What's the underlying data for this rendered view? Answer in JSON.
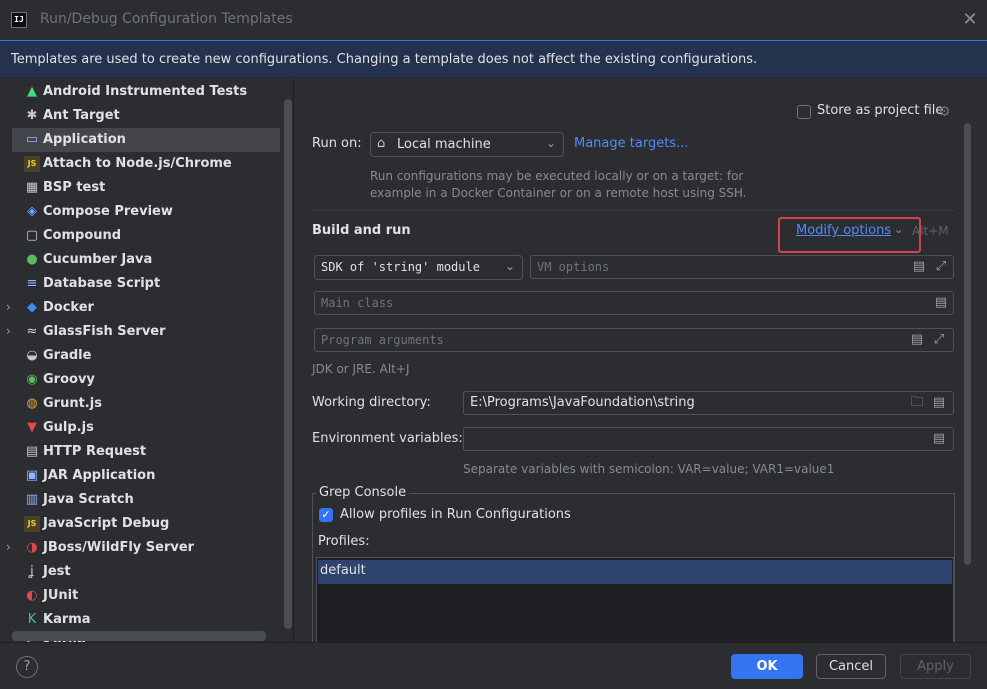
{
  "window": {
    "title": "Run/Debug Configuration Templates",
    "logo_text": "IJ",
    "close_glyph": "✕"
  },
  "banner": {
    "text": "Templates are used to create new configurations. Changing a template does not affect the existing configurations."
  },
  "sidebar": {
    "items": [
      {
        "label": "Android Instrumented Tests",
        "icon": "android-icon",
        "glyph": "▲",
        "color": "#3ddc84",
        "expandable": false,
        "selected": false
      },
      {
        "label": "Ant Target",
        "icon": "ant-icon",
        "glyph": "✱",
        "color": "#c7c7c7",
        "expandable": false,
        "selected": false
      },
      {
        "label": "Application",
        "icon": "application-icon",
        "glyph": "▭",
        "color": "#8fb3ff",
        "expandable": false,
        "selected": true
      },
      {
        "label": "Attach to Node.js/Chrome",
        "icon": "js-icon",
        "glyph": "JS",
        "color": "#f0c93c",
        "expandable": false,
        "selected": false
      },
      {
        "label": "BSP test",
        "icon": "bsp-icon",
        "glyph": "▦",
        "color": "#c7c7c7",
        "expandable": false,
        "selected": false
      },
      {
        "label": "Compose Preview",
        "icon": "compose-icon",
        "glyph": "◈",
        "color": "#6aa1ff",
        "expandable": false,
        "selected": false
      },
      {
        "label": "Compound",
        "icon": "compound-icon",
        "glyph": "▢",
        "color": "#c7c7c7",
        "expandable": false,
        "selected": false
      },
      {
        "label": "Cucumber Java",
        "icon": "cucumber-icon",
        "glyph": "●",
        "color": "#5fb85f",
        "expandable": false,
        "selected": false
      },
      {
        "label": "Database Script",
        "icon": "database-icon",
        "glyph": "≡",
        "color": "#8fb3ff",
        "expandable": false,
        "selected": false
      },
      {
        "label": "Docker",
        "icon": "docker-icon",
        "glyph": "◆",
        "color": "#3e8ef7",
        "expandable": true,
        "selected": false
      },
      {
        "label": "GlassFish Server",
        "icon": "glassfish-icon",
        "glyph": "≈",
        "color": "#d8d8d8",
        "expandable": true,
        "selected": false
      },
      {
        "label": "Gradle",
        "icon": "gradle-icon",
        "glyph": "◒",
        "color": "#c7c7c7",
        "expandable": false,
        "selected": false
      },
      {
        "label": "Groovy",
        "icon": "groovy-icon",
        "glyph": "◉",
        "color": "#5fb85f",
        "expandable": false,
        "selected": false
      },
      {
        "label": "Grunt.js",
        "icon": "grunt-icon",
        "glyph": "◍",
        "color": "#e3a33c",
        "expandable": false,
        "selected": false
      },
      {
        "label": "Gulp.js",
        "icon": "gulp-icon",
        "glyph": "▼",
        "color": "#e0484a",
        "expandable": false,
        "selected": false
      },
      {
        "label": "HTTP Request",
        "icon": "http-icon",
        "glyph": "▤",
        "color": "#c7c7c7",
        "expandable": false,
        "selected": false
      },
      {
        "label": "JAR Application",
        "icon": "jar-icon",
        "glyph": "▣",
        "color": "#8fb3ff",
        "expandable": false,
        "selected": false
      },
      {
        "label": "Java Scratch",
        "icon": "java-scratch-icon",
        "glyph": "▥",
        "color": "#8fb3ff",
        "expandable": false,
        "selected": false
      },
      {
        "label": "JavaScript Debug",
        "icon": "js-debug-icon",
        "glyph": "JS",
        "color": "#f0c93c",
        "expandable": false,
        "selected": false
      },
      {
        "label": "JBoss/WildFly Server",
        "icon": "jboss-icon",
        "glyph": "◑",
        "color": "#e0484a",
        "expandable": true,
        "selected": false
      },
      {
        "label": "Jest",
        "icon": "jest-icon",
        "glyph": "ʝ",
        "color": "#c7c7c7",
        "expandable": false,
        "selected": false
      },
      {
        "label": "JUnit",
        "icon": "junit-icon",
        "glyph": "◐",
        "color": "#e0484a",
        "expandable": false,
        "selected": false
      },
      {
        "label": "Karma",
        "icon": "karma-icon",
        "glyph": "K",
        "color": "#4fc08d",
        "expandable": false,
        "selected": false
      },
      {
        "label": "Kotlin",
        "icon": "kotlin-icon",
        "glyph": "◣",
        "color": "#a87bff",
        "expandable": false,
        "selected": false
      }
    ]
  },
  "main": {
    "store_as_project_file": "Store as project file",
    "run_on_label": "Run on:",
    "run_on_value": "Local machine",
    "manage_targets": "Manage targets...",
    "run_on_hint_1": "Run configurations may be executed locally or on a target: for",
    "run_on_hint_2": "example in a Docker Container or on a remote host using SSH.",
    "build_and_run": "Build and run",
    "modify_options": "Modify options",
    "modify_shortcut": "Alt+M",
    "sdk_value": "SDK of 'string' module",
    "vm_options_placeholder": "VM options",
    "main_class_placeholder": "Main class",
    "program_args_placeholder": "Program arguments",
    "jdk_hint": "JDK or JRE. Alt+J",
    "working_dir_label": "Working directory:",
    "working_dir_value": "E:\\Programs\\JavaFoundation\\string",
    "env_vars_label": "Environment variables:",
    "env_vars_hint": "Separate variables with semicolon: VAR=value; VAR1=value1",
    "grep_console": "Grep Console",
    "allow_profiles": "Allow profiles in Run Configurations",
    "profiles_label": "Profiles:",
    "profiles": [
      "default"
    ]
  },
  "footer": {
    "help": "?",
    "ok": "OK",
    "cancel": "Cancel",
    "apply": "Apply"
  },
  "colors": {
    "accent": "#3574f0",
    "link": "#548af7",
    "highlight_box": "#d9404a",
    "background": "#2b2d30"
  }
}
